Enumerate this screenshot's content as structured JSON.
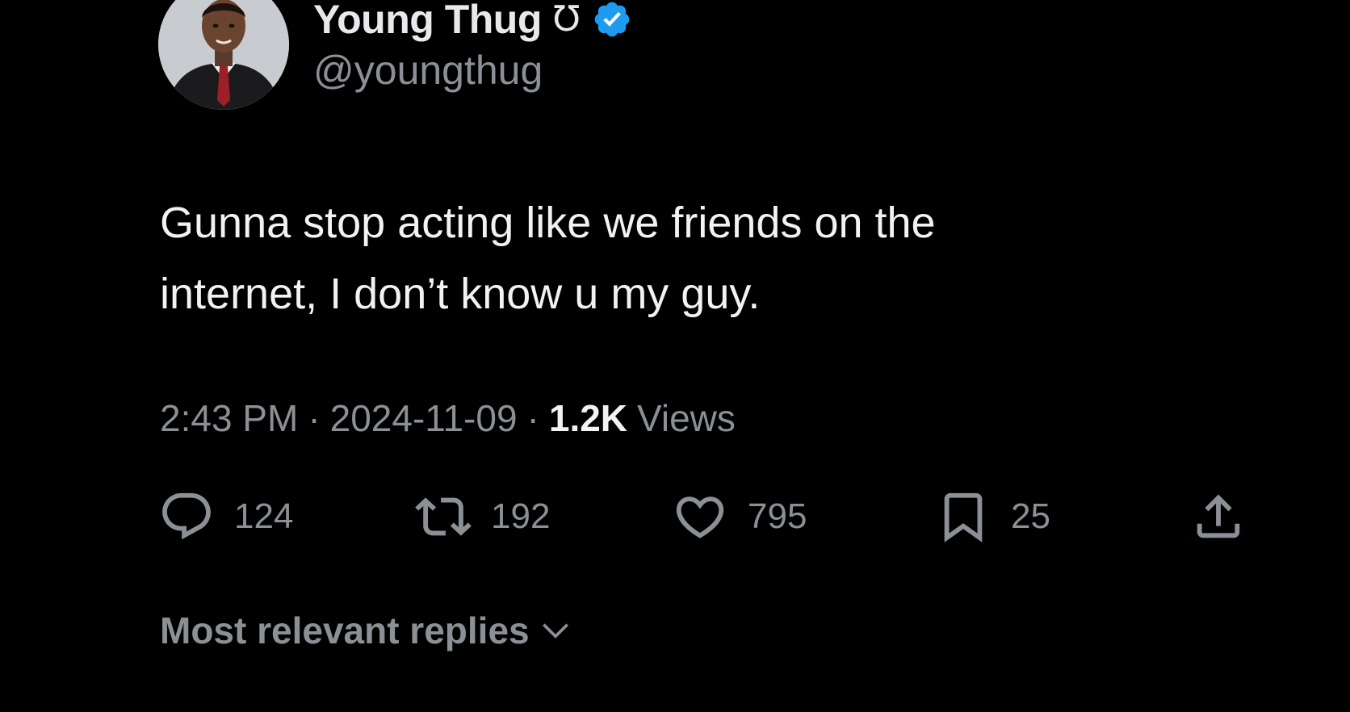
{
  "author": {
    "display_name": "Young Thug",
    "name_glyph": "Ʊ",
    "handle": "@youngthug",
    "verified_color": "#1d9bf0",
    "avatar_icon": "profile-photo"
  },
  "tweet": {
    "text": "Gunna stop acting like we friends on the\ninternet, I don’t know u my guy.",
    "time": "2:43 PM",
    "separator": "·",
    "date": "2024-11-09",
    "views_count": "1.2K",
    "views_label": "Views"
  },
  "actions": {
    "reply": {
      "icon": "reply-icon",
      "count": "124"
    },
    "retweet": {
      "icon": "retweet-icon",
      "count": "192"
    },
    "like": {
      "icon": "heart-icon",
      "count": "795"
    },
    "bookmark": {
      "icon": "bookmark-icon",
      "count": "25"
    },
    "share": {
      "icon": "share-icon"
    }
  },
  "replies": {
    "sort_label": "Most relevant replies",
    "dropdown_icon": "chevron-down-icon"
  },
  "colors": {
    "background": "#000000",
    "primary_text": "#e7e9ea",
    "secondary_text": "#8b9096",
    "accent": "#1d9bf0"
  }
}
